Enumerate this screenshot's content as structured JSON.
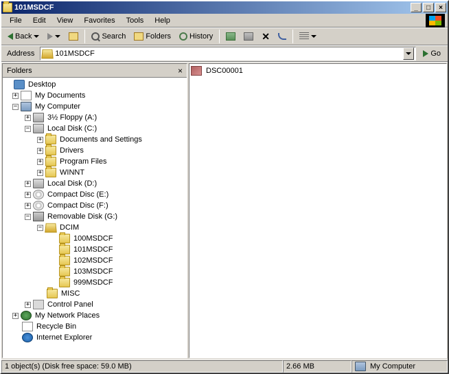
{
  "window": {
    "title": "101MSDCF"
  },
  "menus": {
    "file": "File",
    "edit": "Edit",
    "view": "View",
    "favorites": "Favorites",
    "tools": "Tools",
    "help": "Help"
  },
  "toolbar": {
    "back": "Back",
    "search": "Search",
    "folders": "Folders",
    "history": "History"
  },
  "address": {
    "label": "Address",
    "value": "101MSDCF",
    "go": "Go"
  },
  "folders_panel": {
    "title": "Folders"
  },
  "tree": {
    "desktop": "Desktop",
    "mydocs": "My Documents",
    "mycomp": "My Computer",
    "floppy": "3½ Floppy (A:)",
    "cdrive": "Local Disk (C:)",
    "docset": "Documents and Settings",
    "drivers": "Drivers",
    "progfiles": "Program Files",
    "winnt": "WINNT",
    "ddrive": "Local Disk (D:)",
    "cde": "Compact Disc (E:)",
    "cdf": "Compact Disc (F:)",
    "remg": "Removable Disk (G:)",
    "dcim": "DCIM",
    "m100": "100MSDCF",
    "m101": "101MSDCF",
    "m102": "102MSDCF",
    "m103": "103MSDCF",
    "m999": "999MSDCF",
    "misc": "MISC",
    "cpanel": "Control Panel",
    "netplaces": "My Network Places",
    "recycle": "Recycle Bin",
    "ie": "Internet Explorer"
  },
  "content": {
    "file1": "DSC00001"
  },
  "status": {
    "objects": "1 object(s) (Disk free space: 59.0 MB)",
    "size": "2.66 MB",
    "location": "My Computer"
  }
}
